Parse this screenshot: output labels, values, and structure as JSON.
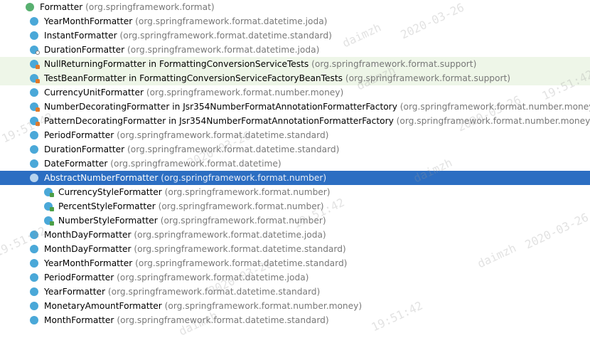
{
  "rows": [
    {
      "name": "Formatter",
      "pkg": "(org.springframework.format)",
      "level": 0,
      "icon": "interface",
      "arrow": "*",
      "badge": "none",
      "selected": false,
      "test": false
    },
    {
      "name": "YearMonthFormatter",
      "pkg": "(org.springframework.format.datetime.joda)",
      "level": 1,
      "icon": "class",
      "badge": "none",
      "selected": false,
      "test": false
    },
    {
      "name": "InstantFormatter",
      "pkg": "(org.springframework.format.datetime.standard)",
      "level": 1,
      "icon": "class",
      "badge": "none",
      "selected": false,
      "test": false
    },
    {
      "name": "DurationFormatter",
      "pkg": "(org.springframework.format.datetime.joda)",
      "level": 1,
      "icon": "class",
      "badge": "dot",
      "selected": false,
      "test": false
    },
    {
      "name": "NullReturningFormatter in FormattingConversionServiceTests",
      "pkg": "(org.springframework.format.support)",
      "level": 1,
      "icon": "class",
      "badge": "lock",
      "selected": false,
      "test": true
    },
    {
      "name": "TestBeanFormatter in FormattingConversionServiceFactoryBeanTests",
      "pkg": "(org.springframework.format.support)",
      "level": 1,
      "icon": "class",
      "badge": "lock",
      "selected": false,
      "test": true
    },
    {
      "name": "CurrencyUnitFormatter",
      "pkg": "(org.springframework.format.number.money)",
      "level": 1,
      "icon": "class",
      "badge": "none",
      "selected": false,
      "test": false
    },
    {
      "name": "NumberDecoratingFormatter in Jsr354NumberFormatAnnotationFormatterFactory",
      "pkg": "(org.springframework.format.number.money)",
      "level": 1,
      "icon": "class",
      "badge": "lock",
      "selected": false,
      "test": false
    },
    {
      "name": "PatternDecoratingFormatter in Jsr354NumberFormatAnnotationFormatterFactory",
      "pkg": "(org.springframework.format.number.money)",
      "level": 1,
      "icon": "class",
      "badge": "lock",
      "selected": false,
      "test": false
    },
    {
      "name": "PeriodFormatter",
      "pkg": "(org.springframework.format.datetime.standard)",
      "level": 1,
      "icon": "class",
      "badge": "none",
      "selected": false,
      "test": false
    },
    {
      "name": "DurationFormatter",
      "pkg": "(org.springframework.format.datetime.standard)",
      "level": 1,
      "icon": "class",
      "badge": "none",
      "selected": false,
      "test": false
    },
    {
      "name": "DateFormatter",
      "pkg": "(org.springframework.format.datetime)",
      "level": 1,
      "icon": "class",
      "badge": "none",
      "selected": false,
      "test": false
    },
    {
      "name": "AbstractNumberFormatter",
      "pkg": "(org.springframework.format.number)",
      "level": 1,
      "icon": "abstract",
      "arrow": "⌄",
      "badge": "none",
      "selected": true,
      "test": false
    },
    {
      "name": "CurrencyStyleFormatter",
      "pkg": "(org.springframework.format.number)",
      "level": 2,
      "icon": "class",
      "badge": "open",
      "selected": false,
      "test": false
    },
    {
      "name": "PercentStyleFormatter",
      "pkg": "(org.springframework.format.number)",
      "level": 2,
      "icon": "class",
      "badge": "open",
      "selected": false,
      "test": false
    },
    {
      "name": "NumberStyleFormatter",
      "pkg": "(org.springframework.format.number)",
      "level": 2,
      "icon": "class",
      "badge": "open",
      "selected": false,
      "test": false
    },
    {
      "name": "MonthDayFormatter",
      "pkg": "(org.springframework.format.datetime.joda)",
      "level": 1,
      "icon": "class",
      "badge": "none",
      "selected": false,
      "test": false
    },
    {
      "name": "MonthDayFormatter",
      "pkg": "(org.springframework.format.datetime.standard)",
      "level": 1,
      "icon": "class",
      "badge": "none",
      "selected": false,
      "test": false
    },
    {
      "name": "YearMonthFormatter",
      "pkg": "(org.springframework.format.datetime.standard)",
      "level": 1,
      "icon": "class",
      "badge": "none",
      "selected": false,
      "test": false
    },
    {
      "name": "PeriodFormatter",
      "pkg": "(org.springframework.format.datetime.joda)",
      "level": 1,
      "icon": "class",
      "badge": "none",
      "selected": false,
      "test": false
    },
    {
      "name": "YearFormatter",
      "pkg": "(org.springframework.format.datetime.standard)",
      "level": 1,
      "icon": "class",
      "badge": "none",
      "selected": false,
      "test": false
    },
    {
      "name": "MonetaryAmountFormatter",
      "pkg": "(org.springframework.format.number.money)",
      "level": 1,
      "icon": "class",
      "badge": "none",
      "selected": false,
      "test": false
    },
    {
      "name": "MonthFormatter",
      "pkg": "(org.springframework.format.datetime.standard)",
      "level": 1,
      "icon": "class",
      "badge": "none",
      "selected": false,
      "test": false
    }
  ],
  "icon_letters": {
    "class": "C",
    "interface": "I",
    "abstract": "C"
  },
  "watermarks": [
    "daimzh",
    "2020-03-26",
    "19:51:42"
  ],
  "colors": {
    "selection": "#2c6ec2",
    "test_row": "#eef6e8",
    "class_icon": "#4aa8d8",
    "interface_icon": "#58b070"
  }
}
